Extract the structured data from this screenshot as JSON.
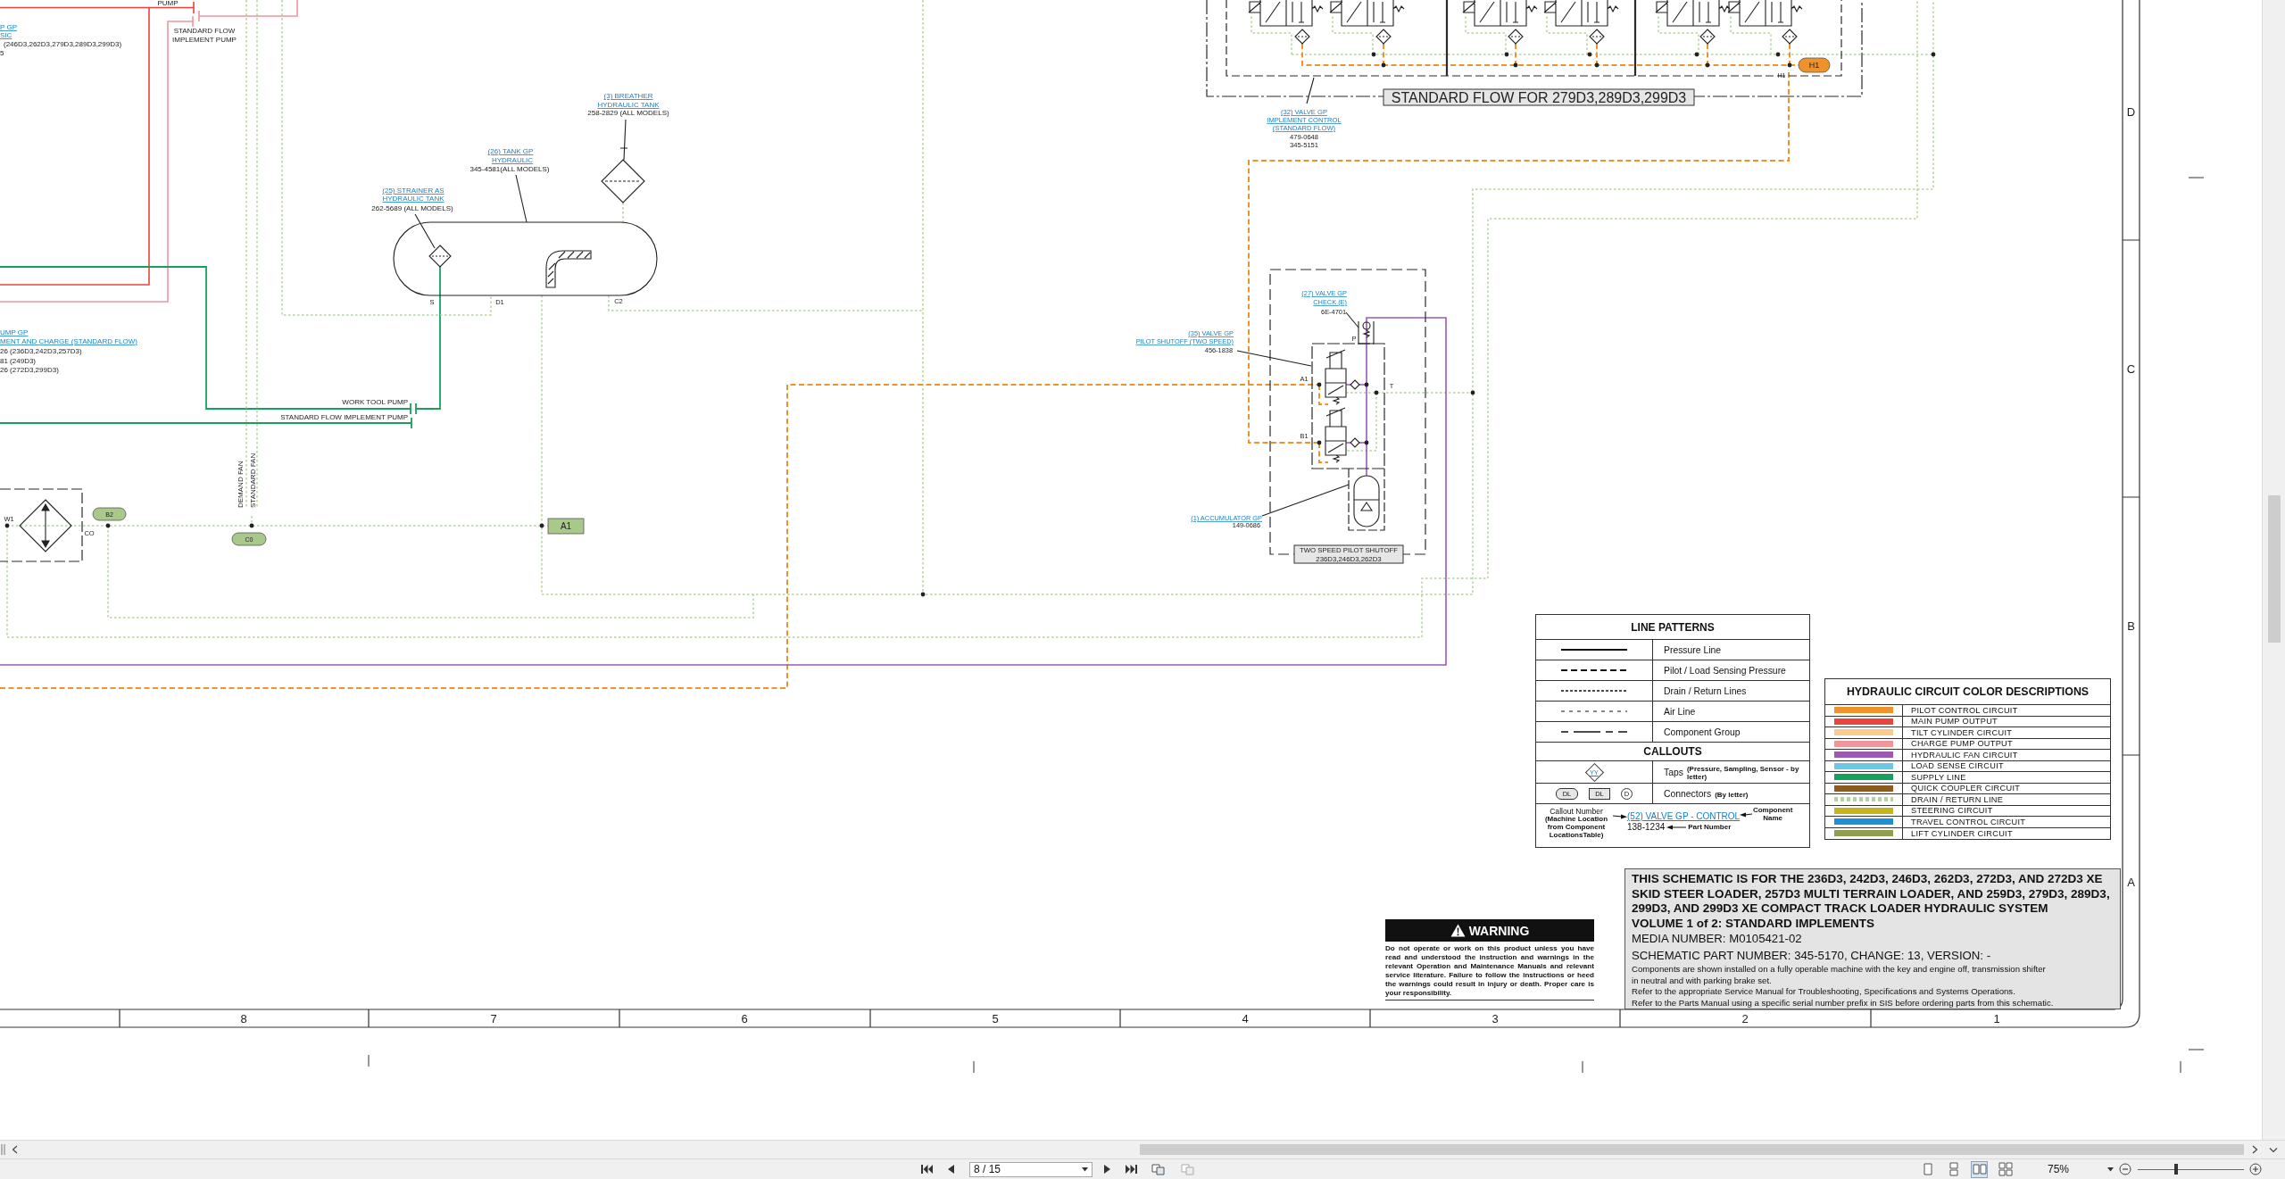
{
  "sheet": {
    "labels": [
      {
        "kind": "link",
        "text": "P GP"
      },
      {
        "kind": "link",
        "text": "SIC"
      },
      {
        "kind": "text",
        "text": "(246D3,262D3,279D3,289D3,299D3)"
      },
      {
        "kind": "text",
        "text": "5"
      },
      {
        "kind": "text",
        "text": "PUMP"
      },
      {
        "kind": "text",
        "text": "STANDARD FLOW"
      },
      {
        "kind": "text",
        "text": "IMPLEMENT PUMP"
      },
      {
        "kind": "link",
        "text": "UMP GP"
      },
      {
        "kind": "link",
        "text": "MENT AND CHARGE (STANDARD FLOW)"
      },
      {
        "kind": "text",
        "text": "26 (236D3,242D3,257D3)"
      },
      {
        "kind": "text",
        "text": "81 (249D3)"
      },
      {
        "kind": "text",
        "text": "26 (272D3,299D3)"
      },
      {
        "kind": "text",
        "text": "WORK TOOL PUMP"
      },
      {
        "kind": "text",
        "text": "STANDARD FLOW IMPLEMENT PUMP"
      },
      {
        "kind": "vertical",
        "text": "DEMAND FAN"
      },
      {
        "kind": "vertical",
        "text": "STANDARD FAN"
      },
      {
        "kind": "port",
        "text": "W1"
      },
      {
        "kind": "port",
        "text": "CO"
      },
      {
        "kind": "link",
        "text": "(3) BREATHER"
      },
      {
        "kind": "link",
        "text": "HYDRAULIC TANK"
      },
      {
        "kind": "text",
        "text": "258-2829 (ALL MODELS)"
      },
      {
        "kind": "link",
        "text": "(26) TANK GP"
      },
      {
        "kind": "link",
        "text": "HYDRAULIC"
      },
      {
        "kind": "text",
        "text": "345-4581(ALL MODELS)"
      },
      {
        "kind": "link",
        "text": "(25) STRAINER AS"
      },
      {
        "kind": "link",
        "text": "HYDRAULIC TANK"
      },
      {
        "kind": "text",
        "text": "262-5689 (ALL MODELS)"
      },
      {
        "kind": "port",
        "text": "S"
      },
      {
        "kind": "port",
        "text": "D1"
      },
      {
        "kind": "port",
        "text": "C2"
      },
      {
        "kind": "link",
        "text": "(32) VALVE GP"
      },
      {
        "kind": "link",
        "text": "IMPLEMENT CONTROL"
      },
      {
        "kind": "link",
        "text": "(STANDARD FLOW)"
      },
      {
        "kind": "text",
        "text": "479-0648"
      },
      {
        "kind": "text",
        "text": "345-5151"
      },
      {
        "kind": "port",
        "text": "H1"
      },
      {
        "kind": "link",
        "text": "(27) VALVE GP"
      },
      {
        "kind": "link",
        "text": "CHECK (E)"
      },
      {
        "kind": "text",
        "text": "6E-4701"
      },
      {
        "kind": "link",
        "text": "(35) VALVE GP"
      },
      {
        "kind": "link",
        "text": "PILOT SHUTOFF (TWO SPEED)"
      },
      {
        "kind": "text",
        "text": "456-1838"
      },
      {
        "kind": "port",
        "text": "P"
      },
      {
        "kind": "port",
        "text": "A1"
      },
      {
        "kind": "port",
        "text": "T"
      },
      {
        "kind": "port",
        "text": "B1"
      },
      {
        "kind": "link",
        "text": "(1) ACCUMULATOR GP"
      },
      {
        "kind": "text",
        "text": "149-0686"
      }
    ],
    "group_labels": [
      {
        "lines": [
          "STANDARD FLOW FOR 279D3,289D3,299D3"
        ]
      },
      {
        "lines": [
          "TWO SPEED PILOT SHUTOFF",
          "236D3,246D3,262D3"
        ]
      }
    ],
    "connectors": [
      {
        "kind": "pill",
        "label": "B2",
        "color": "#a8c98a"
      },
      {
        "kind": "pill",
        "label": "C0",
        "color": "#a8c98a"
      },
      {
        "kind": "box",
        "label": "A1",
        "color": "#a8c98a"
      },
      {
        "kind": "pill",
        "label": "H1",
        "color": "#f0922b"
      }
    ],
    "row_markers": [
      "D",
      "C",
      "B",
      "A"
    ],
    "column_markers": [
      "8",
      "7",
      "6",
      "5",
      "4",
      "3",
      "2",
      "1"
    ]
  },
  "line_patterns": {
    "title": "LINE PATTERNS",
    "rows": [
      {
        "kind": "solid",
        "label": "Pressure Line"
      },
      {
        "kind": "dashed",
        "label": "Pilot / Load Sensing Pressure"
      },
      {
        "kind": "dotted",
        "label": "Drain / Return Lines"
      },
      {
        "kind": "air",
        "label": "Air Line"
      },
      {
        "kind": "group",
        "label": "Component Group"
      }
    ],
    "callouts_title": "CALLOUTS",
    "taps": {
      "symbol": "YY",
      "label": "Taps",
      "note": "(Pressure, Sampling, Sensor - by letter)"
    },
    "connectors": {
      "symbols": [
        {
          "kind": "pill",
          "label": "DL"
        },
        {
          "kind": "box",
          "label": "DL"
        },
        {
          "kind": "circle",
          "label": "D"
        }
      ],
      "label": "Connectors",
      "note": "(By letter)"
    },
    "example": {
      "callout_number": "Callout Number",
      "callout_note": "(Machine Location from Component LocationsTable)",
      "component": "(52) VALVE GP - CONTROL",
      "component_note": "Component Name",
      "part": "138-1234",
      "part_note": "Part Number"
    }
  },
  "color_descriptions": {
    "title": "HYDRAULIC CIRCUIT COLOR DESCRIPTIONS",
    "rows": [
      {
        "kind": "solid",
        "color": "#f0922b",
        "label": "PILOT CONTROL CIRCUIT"
      },
      {
        "kind": "solid",
        "color": "#e8453c",
        "label": "MAIN PUMP OUTPUT"
      },
      {
        "kind": "solid",
        "color": "#f9cb8f",
        "label": "TILT CYLINDER CIRCUIT"
      },
      {
        "kind": "solid",
        "color": "#f0959c",
        "label": "CHARGE PUMP OUTPUT"
      },
      {
        "kind": "solid",
        "color": "#9b59b6",
        "label": "HYDRAULIC FAN CIRCUIT"
      },
      {
        "kind": "solid",
        "color": "#6dc8e3",
        "label": "LOAD SENSE CIRCUIT"
      },
      {
        "kind": "solid",
        "color": "#17a05d",
        "label": "SUPPLY LINE"
      },
      {
        "kind": "solid",
        "color": "#8c5a1e",
        "label": "QUICK COUPLER CIRCUIT"
      },
      {
        "kind": "dotted",
        "color": "#b2d39a",
        "label": "DRAIN / RETURN LINE"
      },
      {
        "kind": "solid",
        "color": "#c5b41a",
        "label": "STEERING CIRCUIT"
      },
      {
        "kind": "solid",
        "color": "#1d8fd2",
        "label": "TRAVEL CONTROL CIRCUIT"
      },
      {
        "kind": "solid",
        "color": "#8e9e50",
        "label": "LIFT CYLINDER CIRCUIT"
      }
    ]
  },
  "warning": {
    "title": "WARNING",
    "text": "Do not operate or work on this product unless you have read and understood the instruction and warnings in the relevant Operation and Maintenance Manuals and relevant service literature. Failure to follow the instructions or heed the warnings could result in injury or death. Proper care is your responsibility."
  },
  "title_block": {
    "heading": "THIS SCHEMATIC IS FOR THE 236D3, 242D3, 246D3, 262D3, 272D3, AND 272D3 XE SKID STEER LOADER, 257D3 MULTI TERRAIN LOADER, AND 259D3, 279D3, 289D3, 299D3, AND 299D3 XE COMPACT TRACK LOADER HYDRAULIC SYSTEM",
    "volume": "VOLUME 1 of 2: STANDARD IMPLEMENTS",
    "media_number": "MEDIA NUMBER: M0105421-02",
    "part_number": "SCHEMATIC PART NUMBER: 345-5170, CHANGE: 13, VERSION: -",
    "notes": [
      "Components are shown installed on a fully operable machine with the key and engine off, transmission shifter in neutral and with parking brake set.",
      "Refer to the appropriate Service Manual for Troubleshooting, Specifications and Systems Operations.",
      "Refer to the Parts Manual using a specific serial number prefix in SIS before ordering parts from this schematic."
    ]
  },
  "toolbar": {
    "page": "8 / 15",
    "view_modes": [
      {
        "kind": "single",
        "selected": false
      },
      {
        "kind": "continuous",
        "selected": false
      },
      {
        "kind": "facing",
        "selected": true
      },
      {
        "kind": "facing-continuous",
        "selected": false
      }
    ],
    "zoom": "75%",
    "zoom_slider": {
      "level": 0.36
    }
  }
}
